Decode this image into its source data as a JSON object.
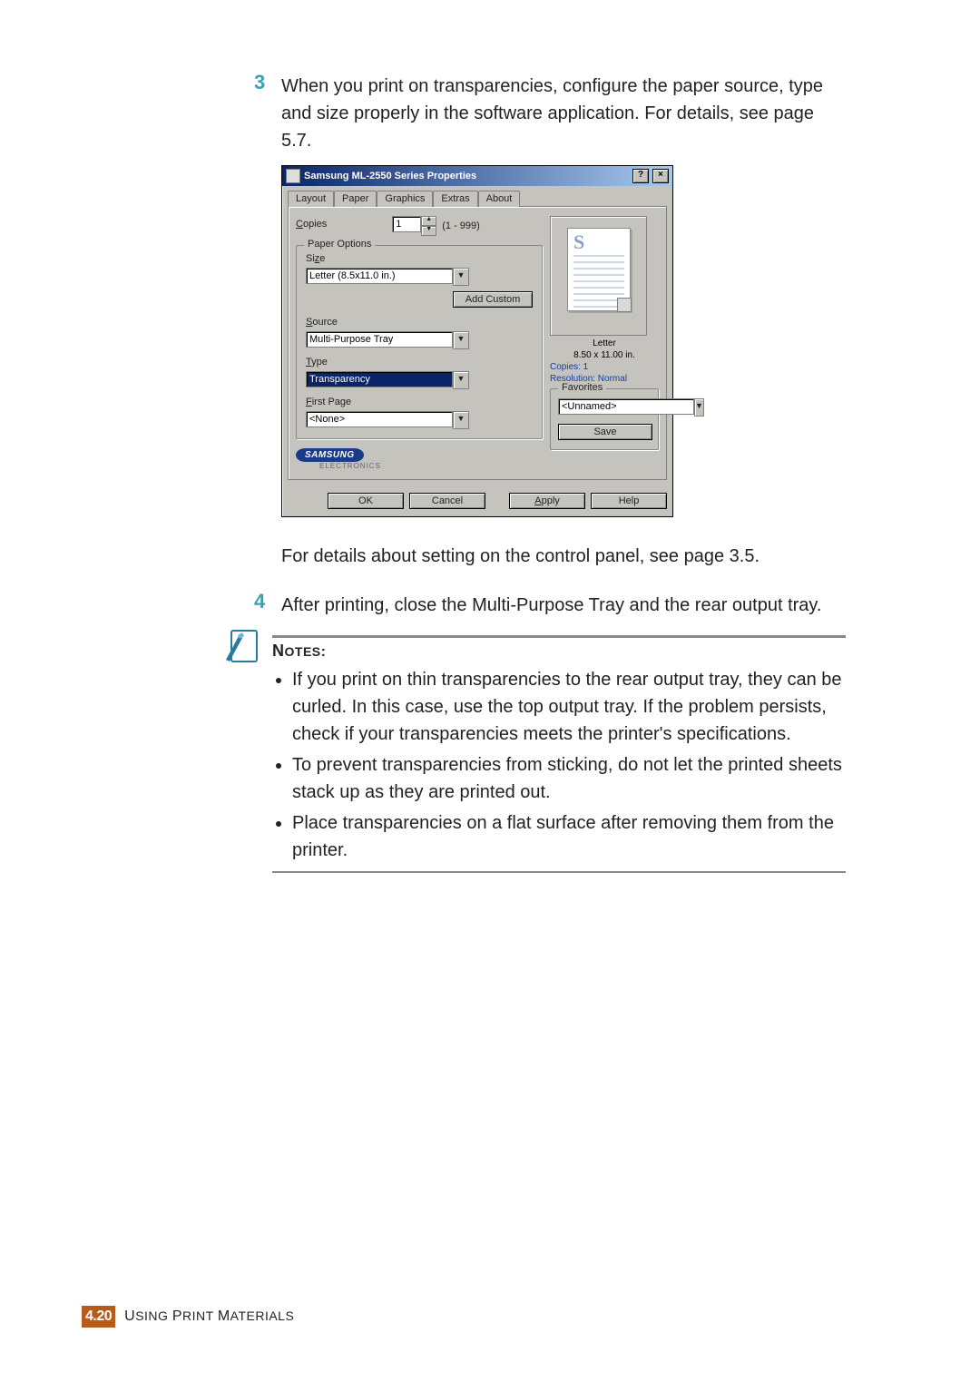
{
  "steps": {
    "s3_num": "3",
    "s3_text": "When you print on transparencies, configure the paper source, type and size properly in the software application. For details, see page 5.7.",
    "after_dialog": "For details about setting on the control panel, see page 3.5.",
    "s4_num": "4",
    "s4_text": "After printing, close the Multi-Purpose Tray and the rear output tray."
  },
  "dialog": {
    "title": "Samsung ML-2550 Series Properties",
    "help": "?",
    "close": "×",
    "tabs": [
      "Layout",
      "Paper",
      "Graphics",
      "Extras",
      "About"
    ],
    "active_tab": 1,
    "copies_label_left": "C",
    "copies_label_rest": "opies",
    "copies_value": "1",
    "copies_range": "(1 - 999)",
    "paper_options": "Paper Options",
    "size_label_left": "Si",
    "size_label_u": "z",
    "size_label_right": "e",
    "size_value": "Letter (8.5x11.0 in.)",
    "add_custom": "Add Custom",
    "source_label_u": "S",
    "source_label_rest": "ource",
    "source_value": "Multi-Purpose Tray",
    "type_label_u": "T",
    "type_label_rest": "ype",
    "type_value": "Transparency",
    "first_page_u": "F",
    "first_page_rest": "irst Page",
    "first_page_value": "<None>",
    "preview": {
      "S": "S",
      "name": "Letter",
      "dims": "8.50 x 11.00 in.",
      "copies": "Copies: 1",
      "res": "Resolution: Normal"
    },
    "favorites_legend": "Favorites",
    "favorites_value": "<Unnamed>",
    "save": "Save",
    "samsung": "SAMSUNG",
    "electronics": "ELECTRONICS",
    "ok": "OK",
    "cancel": "Cancel",
    "apply_u": "A",
    "apply_rest": "pply",
    "help2": "Help"
  },
  "notes": {
    "heading_n": "N",
    "heading_rest": "OTES",
    "colon": ":",
    "items": [
      "If you print on thin transparencies to the rear output tray, they can be curled. In this case, use the top output tray. If the problem persists, check if your transparencies meets the printer's specifications.",
      "To prevent transparencies from sticking, do not let the printed sheets stack up as they are printed out.",
      "Place transparencies on a flat surface after removing them from the printer."
    ]
  },
  "footer": {
    "page": "4.20",
    "chapter_u": "U",
    "chapter_sing": "SING ",
    "chapter_p": "P",
    "chapter_rint": "RINT ",
    "chapter_m": "M",
    "chapter_aterials": "ATERIALS"
  }
}
